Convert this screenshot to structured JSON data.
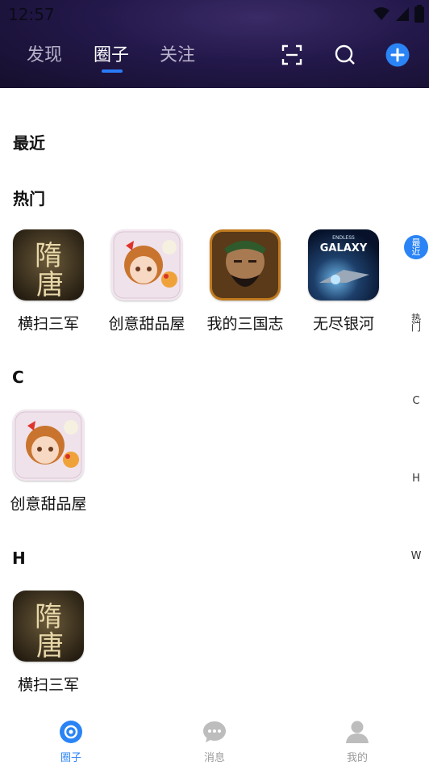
{
  "status": {
    "time": "12:57"
  },
  "tabs": [
    "发现",
    "圈子",
    "关注"
  ],
  "sections": {
    "recent": "最近",
    "hot": "热门",
    "c": "C",
    "h": "H"
  },
  "hot_items": [
    {
      "label": "横扫三军",
      "icon": "suitang-game-icon"
    },
    {
      "label": "创意甜品屋",
      "icon": "dessert-game-icon"
    },
    {
      "label": "我的三国志",
      "icon": "three-kingdoms-game-icon"
    },
    {
      "label": "无尽银河",
      "icon": "galaxy-game-icon",
      "icon_text_small": "ENDLESS",
      "icon_text": "GALAXY"
    }
  ],
  "c_items": [
    {
      "label": "创意甜品屋"
    }
  ],
  "h_items": [
    {
      "label": "横扫三军"
    }
  ],
  "index": {
    "active_line1": "最",
    "active_line2": "近",
    "hot": "热门",
    "letters": [
      "C",
      "H",
      "W"
    ]
  },
  "game_art": {
    "suitang_top": "隋",
    "suitang_bottom": "唐"
  },
  "bottom_nav": [
    {
      "label": "圈子",
      "icon": "circle-icon",
      "active": true
    },
    {
      "label": "消息",
      "icon": "chat-bubble-icon",
      "active": false
    },
    {
      "label": "我的",
      "icon": "person-icon",
      "active": false
    }
  ],
  "colors": {
    "accent": "#2a84f5",
    "header_bg": "#23184a"
  }
}
